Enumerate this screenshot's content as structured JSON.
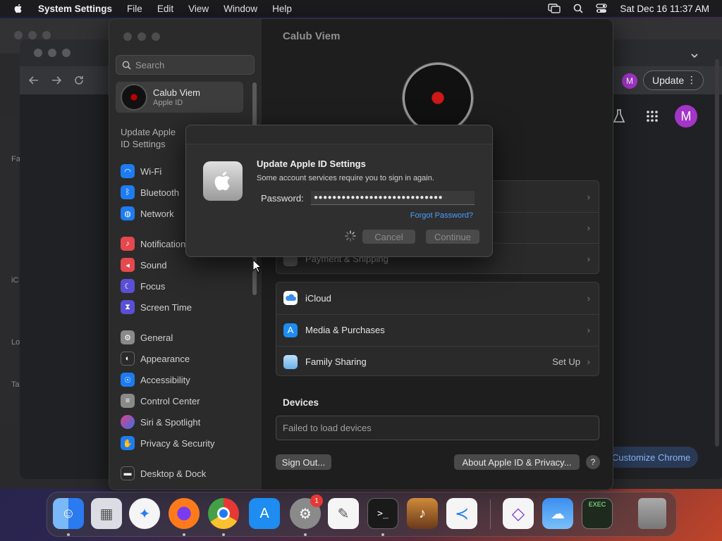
{
  "menubar": {
    "app": "System Settings",
    "items": [
      "File",
      "Edit",
      "View",
      "Window",
      "Help"
    ],
    "datetime": "Sat Dec 16  11:37 AM"
  },
  "chrome": {
    "update_label": "Update",
    "avatar_letter": "M",
    "customize_label": "Customize Chrome",
    "left_peek": [
      "Fa",
      "iC",
      "Lo",
      "Ta"
    ]
  },
  "settings": {
    "search_placeholder": "Search",
    "account": {
      "name": "Calub Viem",
      "sub": "Apple ID"
    },
    "update_text": "Update Apple ID Settings",
    "sidebar_items": [
      {
        "label": "Wi-Fi",
        "icon": "wifi-icon",
        "color": "#1e7cf0"
      },
      {
        "label": "Bluetooth",
        "icon": "bluetooth-icon",
        "color": "#1e7cf0"
      },
      {
        "label": "Network",
        "icon": "network-icon",
        "color": "#1e7cf0"
      },
      {
        "label": "Notifications",
        "icon": "bell-icon",
        "color": "#e5484d"
      },
      {
        "label": "Sound",
        "icon": "speaker-icon",
        "color": "#e5484d"
      },
      {
        "label": "Focus",
        "icon": "moon-icon",
        "color": "#5b4fd6"
      },
      {
        "label": "Screen Time",
        "icon": "hourglass-icon",
        "color": "#5b4fd6"
      },
      {
        "label": "General",
        "icon": "gear-icon",
        "color": "#8a8a8a"
      },
      {
        "label": "Appearance",
        "icon": "appearance-icon",
        "color": "#2a2a2a"
      },
      {
        "label": "Accessibility",
        "icon": "accessibility-icon",
        "color": "#1e7cf0"
      },
      {
        "label": "Control Center",
        "icon": "control-center-icon",
        "color": "#8a8a8a"
      },
      {
        "label": "Siri & Spotlight",
        "icon": "siri-icon",
        "color": "#b03ad0"
      },
      {
        "label": "Privacy & Security",
        "icon": "hand-icon",
        "color": "#1e7cf0"
      },
      {
        "label": "Desktop & Dock",
        "icon": "dock-icon",
        "color": "#2a2a2a"
      }
    ],
    "main_title": "Calub Viem",
    "partial_row": "Payment & Shipping",
    "services": [
      {
        "label": "iCloud",
        "icon": "icloud-icon",
        "color": "#3a8ef0",
        "value": ""
      },
      {
        "label": "Media & Purchases",
        "icon": "app-store-icon",
        "color": "#1e7cf0",
        "value": ""
      },
      {
        "label": "Family Sharing",
        "icon": "family-icon",
        "color": "#4aa0e0",
        "value": "Set Up"
      }
    ],
    "devices_heading": "Devices",
    "devices_status": "Failed to load devices",
    "sign_out": "Sign Out...",
    "about": "About Apple ID & Privacy...",
    "help": "?"
  },
  "dialog": {
    "title": "Update Apple ID Settings",
    "subtitle": "Some account services require you to sign in again.",
    "password_label": "Password:",
    "password_value": "●●●●●●●●●●●●●●●●●●●●●●●●●●●●",
    "forgot": "Forgot Password?",
    "cancel": "Cancel",
    "continue": "Continue"
  },
  "dock": {
    "items": [
      {
        "name": "finder-icon",
        "color": "#3a8ef0",
        "glyph": "☺"
      },
      {
        "name": "launchpad-icon",
        "color": "#d8d8e0",
        "glyph": "▦"
      },
      {
        "name": "safari-icon",
        "color": "#2a7af0",
        "glyph": "✦"
      },
      {
        "name": "firefox-icon",
        "color": "#ff7a1a",
        "glyph": "◉"
      },
      {
        "name": "chrome-icon",
        "color": "#e0e0e0",
        "glyph": "◎"
      },
      {
        "name": "app-store-icon",
        "color": "#1e8cf0",
        "glyph": "A"
      },
      {
        "name": "system-settings-icon",
        "color": "#8a8a8a",
        "glyph": "⚙"
      },
      {
        "name": "textedit-icon",
        "color": "#f0f0f0",
        "glyph": "✎"
      },
      {
        "name": "terminal-icon",
        "color": "#1a1a1a",
        "glyph": ">_"
      },
      {
        "name": "garageband-icon",
        "color": "#3a2a1a",
        "glyph": "♪"
      },
      {
        "name": "vscode-icon",
        "color": "#f5f5f5",
        "glyph": "≺"
      },
      {
        "name": "visual-studio-icon",
        "color": "#f5f5f5",
        "glyph": "◇"
      },
      {
        "name": "weather-icon",
        "color": "#3a8ef0",
        "glyph": "☁"
      },
      {
        "name": "console-icon",
        "color": "#1e2a1e",
        "glyph": "▭"
      },
      {
        "name": "trash-icon",
        "color": "#9a9a9a",
        "glyph": "🗑"
      }
    ],
    "settings_badge": "1"
  }
}
